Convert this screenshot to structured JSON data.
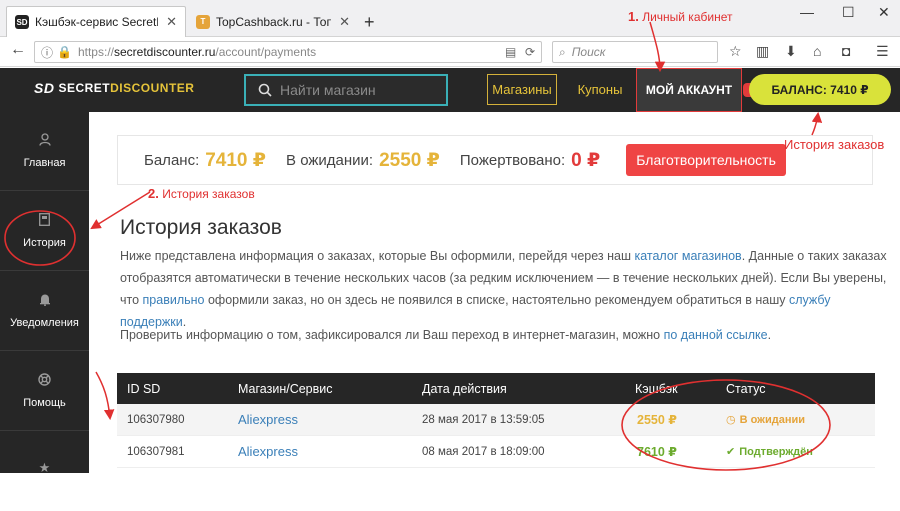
{
  "browser": {
    "tabs": [
      {
        "title": "Кэшбэк-сервис SecretDiscou",
        "favicon": "SD"
      },
      {
        "title": "TopCashback.ru - Топ лучши",
        "favicon": "T"
      }
    ],
    "url_scheme": "https://",
    "url_host": "secretdiscounter.ru",
    "url_path": "/account/payments",
    "search_placeholder": "Поиск"
  },
  "header": {
    "logo_left": "SECRET",
    "logo_right": "DISCOUNTER",
    "logo_mark": "SD",
    "search_placeholder": "Найти магазин",
    "shops": "Магазины",
    "coupons": "Купоны",
    "account": "МОЙ АККАУНТ",
    "balance": "БАЛАНС: 7410 ₽"
  },
  "sidebar": {
    "items": [
      {
        "label": "Главная",
        "icon": "user-icon"
      },
      {
        "label": "История",
        "icon": "book-icon"
      },
      {
        "label": "Уведомления",
        "icon": "bell-icon"
      },
      {
        "label": "Помощь",
        "icon": "lifebuoy-icon"
      },
      {
        "label": "",
        "icon": "star-icon"
      }
    ]
  },
  "balance_card": {
    "balance_label": "Баланс:",
    "balance_value": "7410 ₽",
    "pending_label": "В ожидании:",
    "pending_value": "2550 ₽",
    "donated_label": "Пожертвовано:",
    "donated_value": "0 ₽",
    "charity_button": "Благотворительность"
  },
  "content": {
    "title": "История заказов",
    "p1_a": "Ниже представлена информация о заказах, которые Вы оформили, перейдя через наш ",
    "p1_link1": "каталог магазинов",
    "p1_b": ". Данные о таких заказах",
    "p2": "отобразятся автоматически в течение нескольких часов (за редким исключением — в течение нескольких дней). Если Вы уверены,",
    "p3_a": "что ",
    "p3_link1": "правильно",
    "p3_b": " оформили заказ, но он здесь не появился в списке, настоятельно рекомендуем обратиться в нашу ",
    "p3_link2": "службу поддержки",
    "p3_c": ".",
    "p4_a": "Проверить информацию о том, зафиксировался ли Ваш переход в интернет-магазин, можно ",
    "p4_link": "по данной ссылке",
    "p4_b": "."
  },
  "table": {
    "headers": [
      "ID SD",
      "Магазин/Сервис",
      "Дата действия",
      "Кэшбэк",
      "Статус"
    ],
    "rows": [
      {
        "id": "106307980",
        "shop": "Aliexpress",
        "date": "28 мая 2017 в 13:59:05",
        "cashback": "2550 ₽",
        "status": "В ожидании",
        "status_icon": "clock-icon"
      },
      {
        "id": "106307981",
        "shop": "Aliexpress",
        "date": "08 мая 2017 в 18:09:00",
        "cashback": "7610 ₽",
        "status": "Подтверждён",
        "status_icon": "check-icon"
      }
    ]
  },
  "annotations": {
    "a1_num": "1.",
    "a1_text": "Личный кабинет",
    "a2_num": "2.",
    "a2_text": "История заказов",
    "a3_text": "История заказов"
  },
  "colors": {
    "accent_yellow": "#e5c33a",
    "balance_pill": "#d9e23a",
    "charity_red": "#ef4444",
    "annotation_red": "#e03030",
    "dark_bg": "#262626",
    "search_border": "#3ab0b7"
  }
}
